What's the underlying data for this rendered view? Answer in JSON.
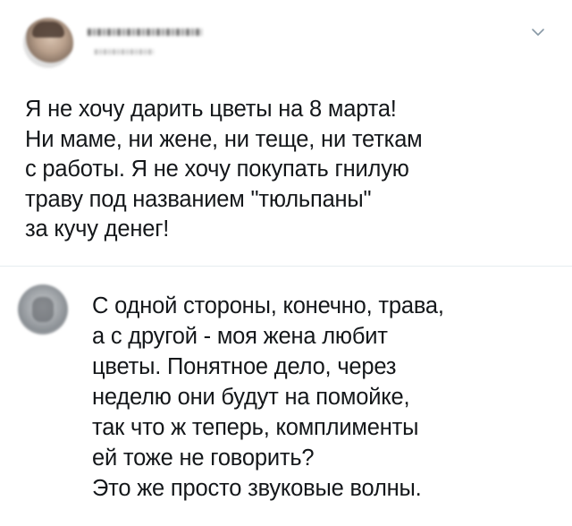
{
  "tweet": {
    "lines": [
      "Я не хочу дарить цветы на 8 марта!",
      "Ни маме, ни жене, ни теще, ни теткам",
      "с работы. Я не хочу покупать гнилую",
      "траву под названием \"тюльпаны\"",
      "за кучу денег!"
    ]
  },
  "reply": {
    "lines": [
      "С одной стороны, конечно, трава,",
      "а с другой - моя жена любит",
      "цветы. Понятное дело, через",
      "неделю они будут на помойке,",
      "так что ж теперь, комплименты",
      "ей тоже не говорить?",
      "Это же просто звуковые волны."
    ]
  },
  "icons": {
    "menu": "chevron-down-icon"
  },
  "colors": {
    "text": "#14171a",
    "divider": "#e6ecf0",
    "chevron": "#8899a6"
  }
}
